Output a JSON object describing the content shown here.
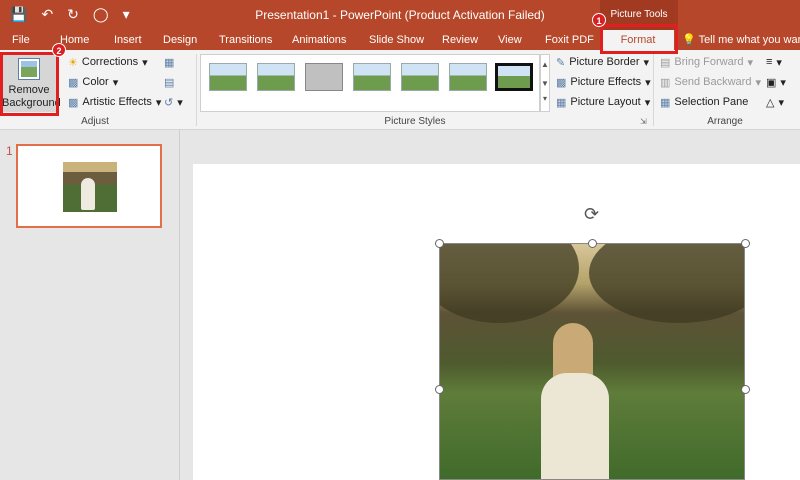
{
  "window": {
    "title": "Presentation1 - PowerPoint (Product Activation Failed)",
    "context_tab_group": "Picture Tools"
  },
  "qat": {
    "save_icon": "save-icon",
    "undo_icon": "undo-icon",
    "redo_icon": "redo-icon",
    "present_icon": "start-slideshow-icon",
    "customize_icon": "customize-qat-icon"
  },
  "tabs": [
    {
      "label": "File"
    },
    {
      "label": "Home"
    },
    {
      "label": "Insert"
    },
    {
      "label": "Design"
    },
    {
      "label": "Transitions"
    },
    {
      "label": "Animations"
    },
    {
      "label": "Slide Show"
    },
    {
      "label": "Review"
    },
    {
      "label": "View"
    },
    {
      "label": "Foxit PDF"
    },
    {
      "label": "Format",
      "active": true
    }
  ],
  "tellme": {
    "text": "Tell me what you want"
  },
  "ribbon": {
    "adjust": {
      "label": "Adjust",
      "remove_background": "Remove Background",
      "corrections": "Corrections",
      "color": "Color",
      "artistic_effects": "Artistic Effects"
    },
    "picture_styles": {
      "label": "Picture Styles",
      "picture_border": "Picture Border",
      "picture_effects": "Picture Effects",
      "picture_layout": "Picture Layout"
    },
    "arrange": {
      "label": "Arrange",
      "bring_forward": "Bring Forward",
      "send_backward": "Send Backward",
      "selection_pane": "Selection Pane"
    }
  },
  "annotations": {
    "step1": "1",
    "step2": "2"
  },
  "slides_panel": {
    "slide_number": "1"
  },
  "colors": {
    "accent": "#b7472a",
    "highlight": "#e02020"
  }
}
